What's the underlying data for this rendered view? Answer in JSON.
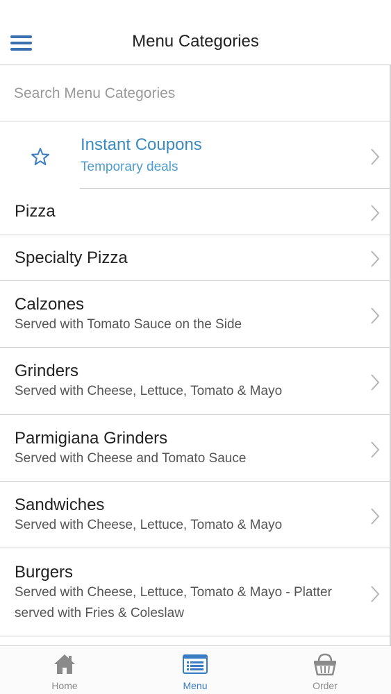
{
  "header": {
    "title": "Menu Categories",
    "menu_icon": "hamburger-menu-icon"
  },
  "search": {
    "placeholder": "Search Menu Categories"
  },
  "coupon": {
    "title": "Instant Coupons",
    "subtitle": "Temporary deals",
    "icon": "star-icon",
    "accent": "#3a8bbf"
  },
  "categories": [
    {
      "title": "Pizza",
      "subtitle": ""
    },
    {
      "title": "Specialty Pizza",
      "subtitle": ""
    },
    {
      "title": "Calzones",
      "subtitle": "Served with Tomato Sauce on the Side"
    },
    {
      "title": "Grinders",
      "subtitle": "Served with Cheese, Lettuce, Tomato & Mayo"
    },
    {
      "title": "Parmigiana Grinders",
      "subtitle": "Served with Cheese and Tomato Sauce"
    },
    {
      "title": "Sandwiches",
      "subtitle": "Served with Cheese, Lettuce, Tomato & Mayo"
    },
    {
      "title": "Burgers",
      "subtitle_line1": "Served with Cheese, Lettuce, Tomato & Mayo - Platter",
      "subtitle_line2": "served with Fries & Coleslaw"
    }
  ],
  "tabs": [
    {
      "label": "Home",
      "icon": "home-icon",
      "active": false
    },
    {
      "label": "Menu",
      "icon": "menu-list-icon",
      "active": true
    },
    {
      "label": "Order",
      "icon": "basket-icon",
      "active": false
    }
  ],
  "colors": {
    "active_tab": "#3a7cc4",
    "inactive_tab": "#8a8a8a"
  }
}
